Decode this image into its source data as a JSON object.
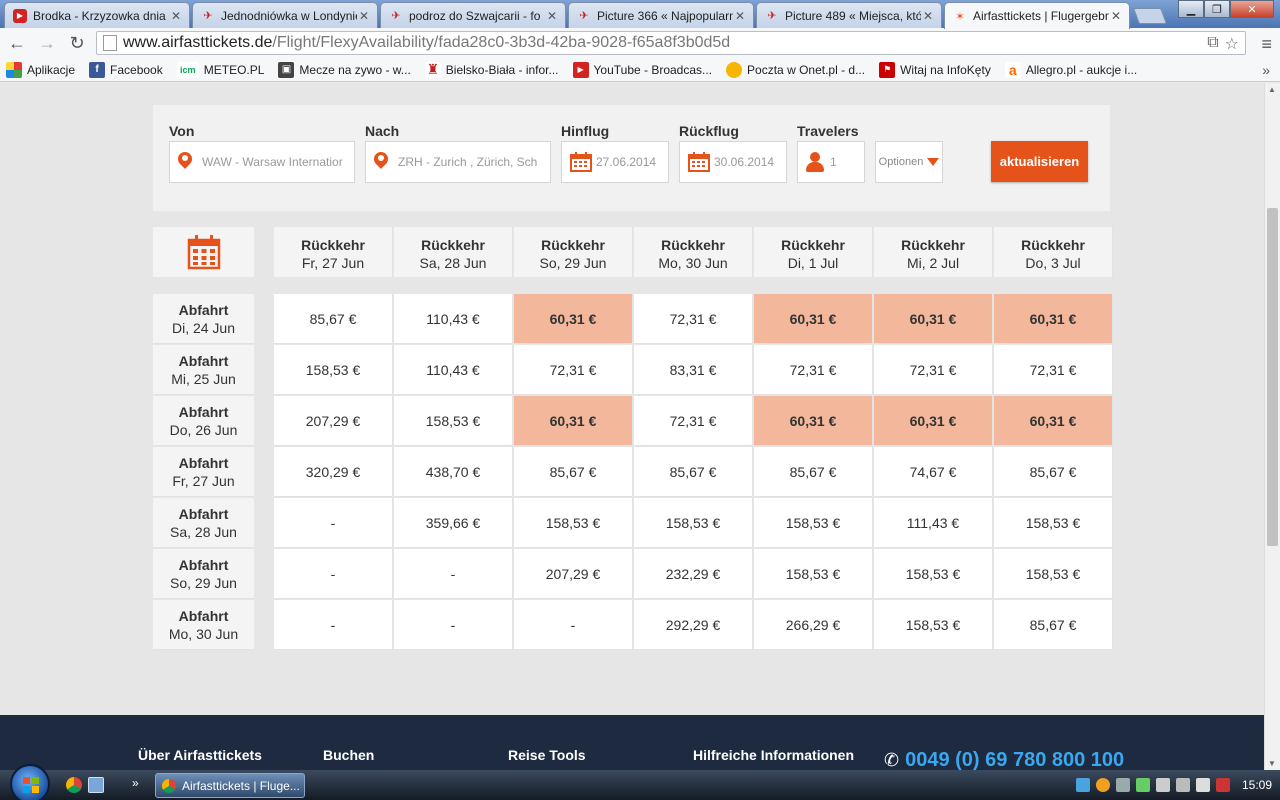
{
  "browser": {
    "tabs": [
      {
        "label": "Brodka - Krzyzowka dnia",
        "icon": "youtube-icon"
      },
      {
        "label": "Jednodniówka w Londynie",
        "icon": "plane-icon"
      },
      {
        "label": "podroz do Szwajcarii - fo",
        "icon": "plane-icon"
      },
      {
        "label": "Picture 366 « Najpopularn",
        "icon": "plane-icon"
      },
      {
        "label": "Picture 489 « Miejsca, któ",
        "icon": "plane-icon"
      },
      {
        "label": "Airfasttickets | Flugergebn",
        "icon": "airfasttickets-icon",
        "active": true
      }
    ],
    "url_host": "www.airfasttickets.de",
    "url_path": "/Flight/FlexyAvailability/fada28c0-3b3d-42ba-9028-f65a8f3b0d5d",
    "bookmarks": [
      {
        "label": "Aplikacje",
        "icon": "apps-icon"
      },
      {
        "label": "Facebook",
        "icon": "facebook-icon"
      },
      {
        "label": "METEO.PL",
        "icon": "icm-icon"
      },
      {
        "label": "Mecze na zywo - w...",
        "icon": "camera-icon"
      },
      {
        "label": "Bielsko-Biała - infor...",
        "icon": "city-icon"
      },
      {
        "label": "YouTube - Broadcas...",
        "icon": "youtube-icon"
      },
      {
        "label": "Poczta w Onet.pl - d...",
        "icon": "onet-icon"
      },
      {
        "label": "Witaj na InfoKęty",
        "icon": "flag-icon"
      },
      {
        "label": "Allegro.pl - aukcje i...",
        "icon": "allegro-icon"
      }
    ]
  },
  "search": {
    "from_label": "Von",
    "from_value": "WAW - Warsaw Internatior",
    "to_label": "Nach",
    "to_value": "ZRH - Zurich  , Zürich, Sch",
    "outbound_label": "Hinflug",
    "outbound_value": "27.06.2014",
    "return_label": "Rückflug",
    "return_value": "30.06.2014",
    "travelers_label": "Travelers",
    "travelers_value": "1",
    "options_label": "Optionen",
    "update_label": "aktualisieren"
  },
  "grid": {
    "return_label": "Rückkehr",
    "departure_label": "Abfahrt",
    "columns": [
      "Fr, 27 Jun",
      "Sa, 28 Jun",
      "So, 29 Jun",
      "Mo, 30 Jun",
      "Di, 1 Jul",
      "Mi, 2 Jul",
      "Do, 3 Jul"
    ],
    "rows": [
      {
        "date": "Di, 24 Jun",
        "prices": [
          "85,67 €",
          "110,43 €",
          "60,31 €",
          "72,31 €",
          "60,31 €",
          "60,31 €",
          "60,31 €"
        ],
        "lowest": [
          false,
          false,
          true,
          false,
          true,
          true,
          true
        ]
      },
      {
        "date": "Mi, 25 Jun",
        "prices": [
          "158,53 €",
          "110,43 €",
          "72,31 €",
          "83,31 €",
          "72,31 €",
          "72,31 €",
          "72,31 €"
        ],
        "lowest": [
          false,
          false,
          false,
          false,
          false,
          false,
          false
        ]
      },
      {
        "date": "Do, 26 Jun",
        "prices": [
          "207,29 €",
          "158,53 €",
          "60,31 €",
          "72,31 €",
          "60,31 €",
          "60,31 €",
          "60,31 €"
        ],
        "lowest": [
          false,
          false,
          true,
          false,
          true,
          true,
          true
        ]
      },
      {
        "date": "Fr, 27 Jun",
        "prices": [
          "320,29 €",
          "438,70 €",
          "85,67 €",
          "85,67 €",
          "85,67 €",
          "74,67 €",
          "85,67 €"
        ],
        "lowest": [
          false,
          false,
          false,
          false,
          false,
          false,
          false
        ]
      },
      {
        "date": "Sa, 28 Jun",
        "prices": [
          "-",
          "359,66 €",
          "158,53 €",
          "158,53 €",
          "158,53 €",
          "111,43 €",
          "158,53 €"
        ],
        "lowest": [
          false,
          false,
          false,
          false,
          false,
          false,
          false
        ]
      },
      {
        "date": "So, 29 Jun",
        "prices": [
          "-",
          "-",
          "207,29 €",
          "232,29 €",
          "158,53 €",
          "158,53 €",
          "158,53 €"
        ],
        "lowest": [
          false,
          false,
          false,
          false,
          false,
          false,
          false
        ]
      },
      {
        "date": "Mo, 30 Jun",
        "prices": [
          "-",
          "-",
          "-",
          "292,29 €",
          "266,29 €",
          "158,53 €",
          "85,67 €"
        ],
        "lowest": [
          false,
          false,
          false,
          false,
          false,
          false,
          false
        ]
      }
    ]
  },
  "footer": {
    "links": [
      "Über Airfasttickets",
      "Buchen",
      "Reise Tools",
      "Hilfreiche Informationen"
    ],
    "phone": "0049 (0) 69 780 800 100"
  },
  "taskbar": {
    "task_label": "Airfasttickets | Fluge...",
    "clock": "15:09"
  },
  "colors": {
    "accent": "#e5531a",
    "lowest_price": "#f3b89c",
    "footer_bg": "#1d2a3f",
    "phone": "#3aa8f0"
  }
}
